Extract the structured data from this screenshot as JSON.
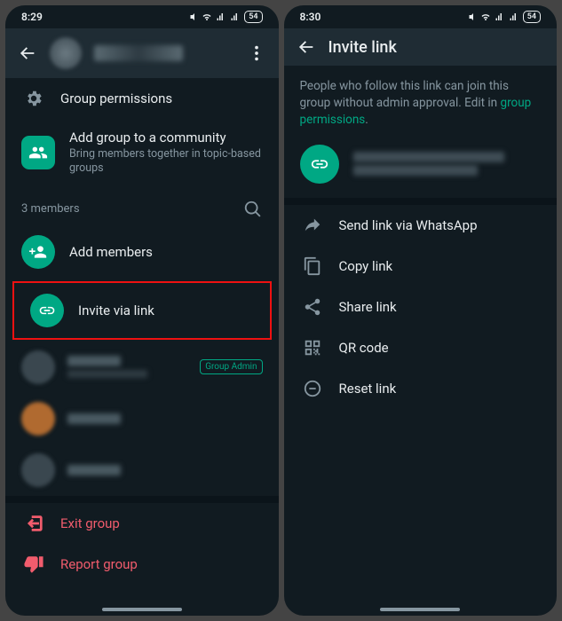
{
  "left": {
    "status": {
      "time": "8:29",
      "battery": "54"
    },
    "rows": {
      "permissions": "Group permissions",
      "community_title": "Add group to a community",
      "community_sub": "Bring members together in topic-based groups"
    },
    "members_header": "3 members",
    "add_members": "Add members",
    "invite_link": "Invite via link",
    "group_admin_badge": "Group Admin",
    "exit": "Exit group",
    "report": "Report group"
  },
  "right": {
    "status": {
      "time": "8:30",
      "battery": "54"
    },
    "title": "Invite link",
    "help_pre": "People who follow this link can join this group without admin approval. Edit in ",
    "help_link": "group permissions",
    "help_post": ".",
    "actions": {
      "send": "Send link via WhatsApp",
      "copy": "Copy link",
      "share": "Share link",
      "qr": "QR code",
      "reset": "Reset link"
    }
  }
}
